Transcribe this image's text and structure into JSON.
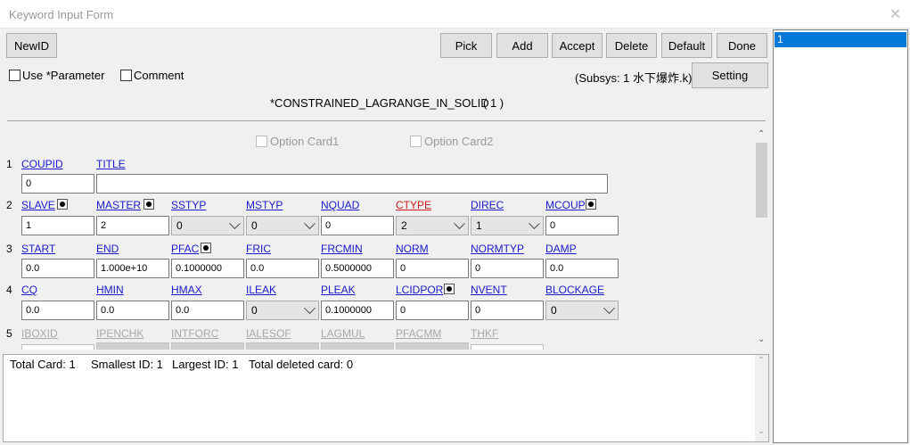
{
  "window": {
    "title": "Keyword Input Form"
  },
  "toolbar": {
    "newid": "NewID",
    "pick": "Pick",
    "add": "Add",
    "accept": "Accept",
    "delete": "Delete",
    "default": "Default",
    "done": "Done",
    "setting": "Setting"
  },
  "options": {
    "use_parameter": "Use *Parameter",
    "comment": "Comment",
    "subsys": "(Subsys: 1 水下爆炸.k)",
    "option_card1": "Option Card1",
    "option_card2": "Option Card2"
  },
  "keyword": {
    "name": "*CONSTRAINED_LAGRANGE_IN_SOLID",
    "count": "( 1 )"
  },
  "rows": [
    {
      "num": "1",
      "fields": [
        {
          "label": "COUPID",
          "value": "0",
          "type": "input"
        },
        {
          "label": "TITLE",
          "value": "",
          "type": "input"
        }
      ]
    },
    {
      "num": "2",
      "fields": [
        {
          "label": "SLAVE",
          "value": "1",
          "type": "input",
          "pick": true
        },
        {
          "label": "MASTER",
          "value": "2",
          "type": "input",
          "pick": true
        },
        {
          "label": "SSTYP",
          "value": "0",
          "type": "select"
        },
        {
          "label": "MSTYP",
          "value": "0",
          "type": "select"
        },
        {
          "label": "NQUAD",
          "value": "0",
          "type": "input"
        },
        {
          "label": "CTYPE",
          "value": "2",
          "type": "select",
          "required": true
        },
        {
          "label": "DIREC",
          "value": "1",
          "type": "select"
        },
        {
          "label": "MCOUP",
          "value": "0",
          "type": "input",
          "pick": true
        }
      ]
    },
    {
      "num": "3",
      "fields": [
        {
          "label": "START",
          "value": "0.0",
          "type": "input"
        },
        {
          "label": "END",
          "value": "1.000e+10",
          "type": "input"
        },
        {
          "label": "PFAC",
          "value": "0.1000000",
          "type": "input",
          "pick": true
        },
        {
          "label": "FRIC",
          "value": "0.0",
          "type": "input"
        },
        {
          "label": "FRCMIN",
          "value": "0.5000000",
          "type": "input"
        },
        {
          "label": "NORM",
          "value": "0",
          "type": "input"
        },
        {
          "label": "NORMTYP",
          "value": "0",
          "type": "input"
        },
        {
          "label": "DAMP",
          "value": "0.0",
          "type": "input"
        }
      ]
    },
    {
      "num": "4",
      "fields": [
        {
          "label": "CQ",
          "value": "0.0",
          "type": "input"
        },
        {
          "label": "HMIN",
          "value": "0.0",
          "type": "input"
        },
        {
          "label": "HMAX",
          "value": "0.0",
          "type": "input"
        },
        {
          "label": "ILEAK",
          "value": "0",
          "type": "select"
        },
        {
          "label": "PLEAK",
          "value": "0.1000000",
          "type": "input"
        },
        {
          "label": "LCIDPOR",
          "value": "0",
          "type": "input",
          "pick": true
        },
        {
          "label": "NVENT",
          "value": "0",
          "type": "input"
        },
        {
          "label": "BLOCKAGE",
          "value": "0",
          "type": "select"
        }
      ]
    },
    {
      "num": "5",
      "fields": [
        {
          "label": "IBOXID",
          "disabled": true
        },
        {
          "label": "IPENCHK",
          "disabled": true
        },
        {
          "label": "INTFORC",
          "disabled": true
        },
        {
          "label": "IALESOF",
          "disabled": true
        },
        {
          "label": "LAGMUL",
          "disabled": true
        },
        {
          "label": "PFACMM",
          "disabled": true
        },
        {
          "label": "THKF",
          "disabled": true
        }
      ]
    }
  ],
  "status": {
    "total_card": "Total Card: 1",
    "smallest_id": "Smallest ID: 1",
    "largest_id": "Largest ID: 1",
    "total_deleted": "Total deleted card:  0"
  },
  "id_list": {
    "items": [
      "1"
    ],
    "selected_index": 0
  },
  "colors": {
    "selection": "#0078d7",
    "link": "#1a1acc",
    "required": "#d01818"
  }
}
